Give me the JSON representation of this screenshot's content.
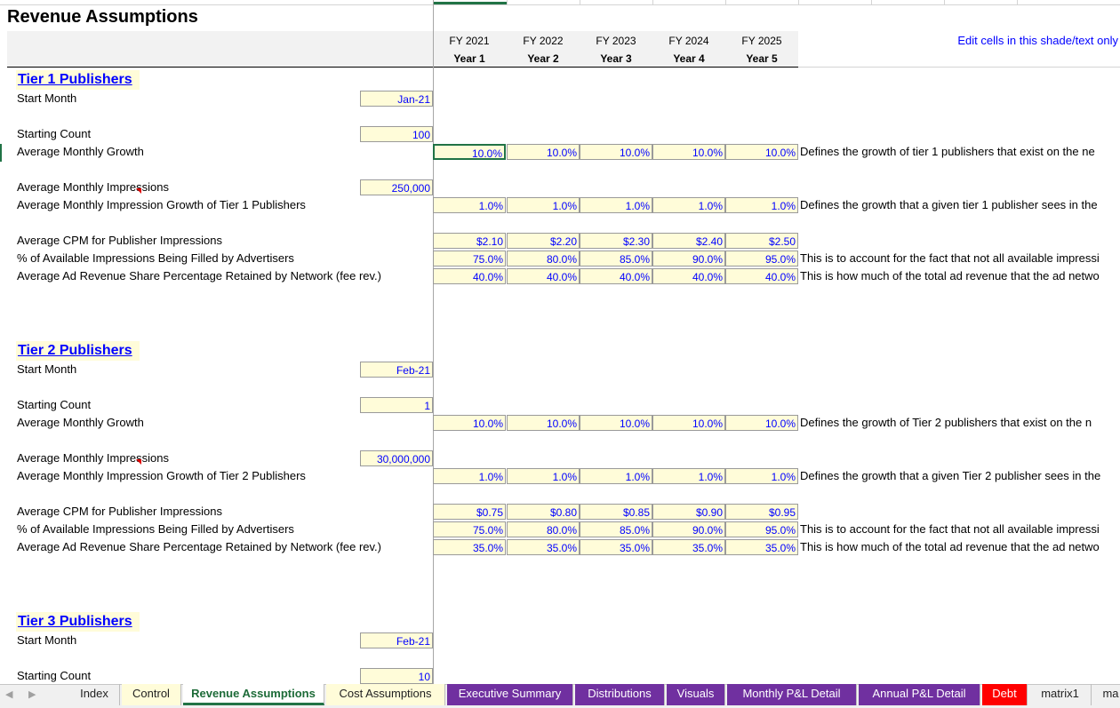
{
  "title": "Revenue Assumptions",
  "edit_note": "Edit cells in this shade/text only",
  "columns": [
    {
      "fy": "FY 2021",
      "year": "Year 1"
    },
    {
      "fy": "FY 2022",
      "year": "Year 2"
    },
    {
      "fy": "FY 2023",
      "year": "Year 3"
    },
    {
      "fy": "FY 2024",
      "year": "Year 4"
    },
    {
      "fy": "FY 2025",
      "year": "Year 5"
    }
  ],
  "tier1": {
    "heading": "Tier 1 Publishers",
    "start_month": {
      "label": "Start Month",
      "value": "Jan-21"
    },
    "starting_count": {
      "label": "Starting Count",
      "value": "100"
    },
    "monthly_growth": {
      "label": "Average Monthly Growth",
      "values": [
        "10.0%",
        "10.0%",
        "10.0%",
        "10.0%",
        "10.0%"
      ],
      "note": "Defines the growth of tier 1 publishers  that exist on the ne"
    },
    "impressions": {
      "label": "Average Monthly Impressions",
      "value": "250,000"
    },
    "impression_growth": {
      "label": "Average Monthly Impression Growth of Tier 1 Publishers",
      "values": [
        "1.0%",
        "1.0%",
        "1.0%",
        "1.0%",
        "1.0%"
      ],
      "note": "Defines the growth that a given tier 1 publisher sees in the"
    },
    "cpm": {
      "label": "Average CPM for Publisher Impressions",
      "values": [
        "$2.10",
        "$2.20",
        "$2.30",
        "$2.40",
        "$2.50"
      ]
    },
    "filled": {
      "label": "% of Available Impressions Being Filled by Advertisers",
      "values": [
        "75.0%",
        "80.0%",
        "85.0%",
        "90.0%",
        "95.0%"
      ],
      "note": "This is to account for the fact that not all available impressi"
    },
    "share": {
      "label": "Average Ad Revenue Share Percentage Retained by Network (fee rev.)",
      "values": [
        "40.0%",
        "40.0%",
        "40.0%",
        "40.0%",
        "40.0%"
      ],
      "note": "This is how much of the total ad revenue that the ad netwo"
    }
  },
  "tier2": {
    "heading": "Tier 2 Publishers",
    "start_month": {
      "label": "Start Month",
      "value": "Feb-21"
    },
    "starting_count": {
      "label": "Starting Count",
      "value": "1"
    },
    "monthly_growth": {
      "label": "Average Monthly Growth",
      "values": [
        "10.0%",
        "10.0%",
        "10.0%",
        "10.0%",
        "10.0%"
      ],
      "note": "Defines the growth of Tier 2 publishers  that exist on the n"
    },
    "impressions": {
      "label": "Average Monthly Impressions",
      "value": "30,000,000"
    },
    "impression_growth": {
      "label": "Average Monthly Impression Growth of Tier 2 Publishers",
      "values": [
        "1.0%",
        "1.0%",
        "1.0%",
        "1.0%",
        "1.0%"
      ],
      "note": "Defines the growth that a given Tier 2 publisher sees in the"
    },
    "cpm": {
      "label": "Average CPM for Publisher Impressions",
      "values": [
        "$0.75",
        "$0.80",
        "$0.85",
        "$0.90",
        "$0.95"
      ]
    },
    "filled": {
      "label": "% of Available Impressions Being Filled by Advertisers",
      "values": [
        "75.0%",
        "80.0%",
        "85.0%",
        "90.0%",
        "95.0%"
      ],
      "note": "This is to account for the fact that not all available impressi"
    },
    "share": {
      "label": "Average Ad Revenue Share Percentage Retained by Network (fee rev.)",
      "values": [
        "35.0%",
        "35.0%",
        "35.0%",
        "35.0%",
        "35.0%"
      ],
      "note": "This is how much of the total ad revenue that the ad netwo"
    }
  },
  "tier3": {
    "heading": "Tier 3 Publishers",
    "start_month": {
      "label": "Start Month",
      "value": "Feb-21"
    },
    "starting_count": {
      "label": "Starting Count",
      "value": "10"
    }
  },
  "tabs": [
    {
      "label": "Index",
      "style": "plain"
    },
    {
      "label": "Control",
      "style": "yellow"
    },
    {
      "label": "Revenue Assumptions",
      "style": "active"
    },
    {
      "label": "Cost Assumptions",
      "style": "yellow"
    },
    {
      "label": "Executive Summary",
      "style": "purple"
    },
    {
      "label": "Distributions",
      "style": "purple"
    },
    {
      "label": "Visuals",
      "style": "purple"
    },
    {
      "label": "Monthly P&L Detail",
      "style": "purple"
    },
    {
      "label": "Annual P&L Detail",
      "style": "purple"
    },
    {
      "label": "Debt",
      "style": "red"
    },
    {
      "label": "matrix1",
      "style": "plain"
    },
    {
      "label": "ma",
      "style": "plain"
    }
  ],
  "nav": {
    "prev": "◀",
    "next": "▶"
  }
}
